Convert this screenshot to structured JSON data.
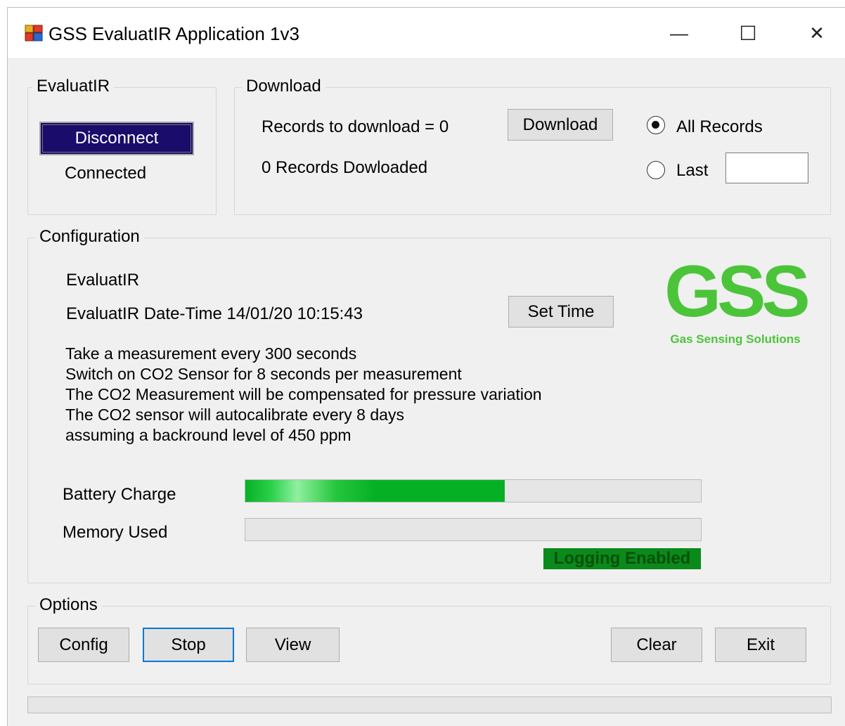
{
  "window": {
    "title": "GSS EvaluatIR Application 1v3",
    "controls": {
      "minimize": "—",
      "maximize": "☐",
      "close": "✕"
    }
  },
  "evaluatir_group": {
    "label": "EvaluatIR",
    "disconnect_button": "Disconnect",
    "status": "Connected"
  },
  "download_group": {
    "label": "Download",
    "records_to_download": "Records to download = 0",
    "records_downloaded": "0 Records Dowloaded",
    "download_button": "Download",
    "all_records_label": "All Records",
    "last_label": "Last",
    "last_value": "",
    "selected_option": "All Records"
  },
  "configuration_group": {
    "label": "Configuration",
    "device_name": "EvaluatIR",
    "datetime": "EvaluatIR Date-Time 14/01/20 10:15:43",
    "set_time_button": "Set Time",
    "description": [
      "Take a measurement every 300 seconds",
      "Switch on CO2 Sensor for 8 seconds per measurement",
      "The CO2 Measurement will be compensated for pressure variation",
      "The CO2 sensor will autocalibrate every 8 days",
      "assuming a backround level of 450 ppm"
    ],
    "battery_label": "Battery Charge",
    "battery_level": 0.57,
    "memory_label": "Memory Used",
    "memory_level": 0,
    "logging_status": "Logging Enabled",
    "logo": {
      "text": "GSS",
      "tagline": "Gas Sensing Solutions",
      "color": "#4cc43a"
    }
  },
  "options_group": {
    "label": "Options",
    "config_button": "Config",
    "stop_button": "Stop",
    "view_button": "View",
    "clear_button": "Clear",
    "exit_button": "Exit"
  },
  "colors": {
    "disconnect_bg": "#1a0c6a",
    "progress_green": "#06b025",
    "logging_badge": "#0a8a1a",
    "focus_border": "#0078d7"
  }
}
